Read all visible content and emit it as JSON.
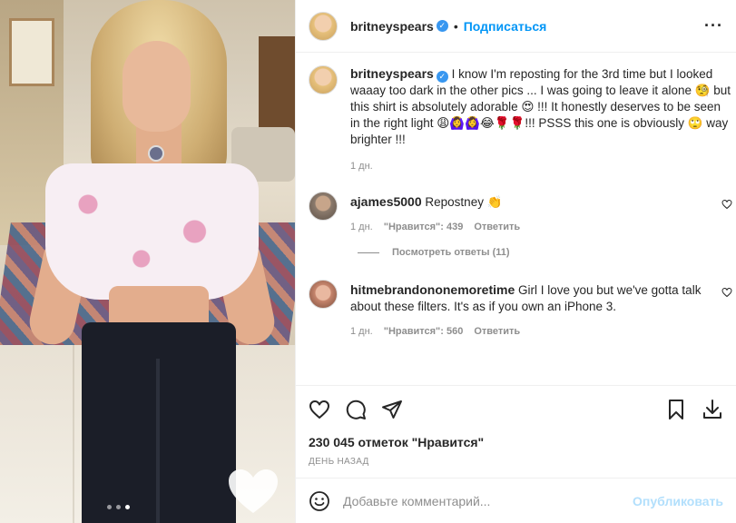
{
  "post": {
    "author": "britneyspears",
    "separator": "•",
    "follow_label": "Подписаться",
    "more_label": "···",
    "caption": {
      "username": "britneyspears",
      "text": "I know I'm reposting for the 3rd time but I looked waaay too dark in the other pics ... I was going to leave it alone 🧐 but this shirt is absolutely adorable 😍 !!! It honestly deserves to be seen in the right light 😩🙆‍♀️🙆‍♀️😂🌹🌹!!! PSSS this one is obviously 🙄 way brighter !!!",
      "time": "1 дн."
    },
    "comments": [
      {
        "username": "ajames5000",
        "text": "Repostney 👏",
        "time": "1 дн.",
        "likes": "\"Нравится\": 439",
        "reply_label": "Ответить",
        "view_replies": "Посмотреть ответы (11)"
      },
      {
        "username": "hitmebrandononemoretime",
        "text": "Girl I love you but we've gotta talk about these filters. It's as if you own an iPhone 3.",
        "time": "1 дн.",
        "likes": "\"Нравится\": 560",
        "reply_label": "Ответить"
      }
    ],
    "likes_count": "230 045 отметок \"Нравится\"",
    "time_ago": "ДЕНЬ НАЗАД",
    "add_comment_placeholder": "Добавьте комментарий...",
    "publish_label": "Опубликовать",
    "carousel": {
      "total": 3,
      "active_index": 2
    }
  },
  "colors": {
    "link_blue": "#0095f6",
    "publish_disabled": "#b2dffc",
    "muted_text": "#8e8e8e"
  }
}
